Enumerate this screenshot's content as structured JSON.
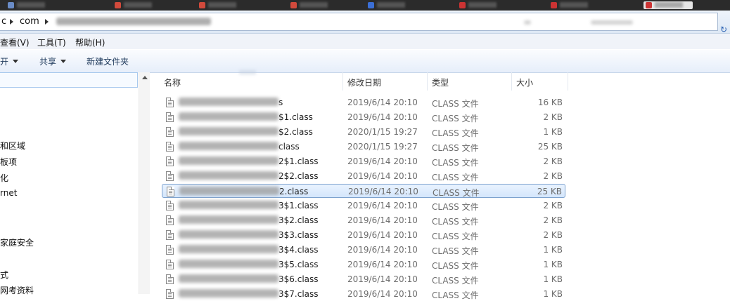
{
  "address": {
    "crumbs": [
      "c",
      "com"
    ],
    "blurred_path": "(blurred)"
  },
  "menus": [
    "查看(V)",
    "工具(T)",
    "帮助(H)"
  ],
  "toolbar": {
    "open_label": "开",
    "share_label": "共享",
    "new_folder_label": "新建文件夹"
  },
  "nav": {
    "items": [
      "和区域",
      "板项",
      "化",
      "rnet",
      "家庭安全",
      "式",
      "网考资料"
    ]
  },
  "columns": {
    "name": "名称",
    "date": "修改日期",
    "type": "类型",
    "size": "大小"
  },
  "files": [
    {
      "suffix": "s",
      "date": "2019/6/14 20:10",
      "type": "CLASS 文件",
      "size": "16 KB",
      "selected": false
    },
    {
      "suffix": "$1.class",
      "date": "2019/6/14 20:10",
      "type": "CLASS 文件",
      "size": "2 KB",
      "selected": false
    },
    {
      "suffix": "$2.class",
      "date": "2020/1/15 19:27",
      "type": "CLASS 文件",
      "size": "1 KB",
      "selected": false
    },
    {
      "suffix": "class",
      "date": "2020/1/15 19:27",
      "type": "CLASS 文件",
      "size": "25 KB",
      "selected": false
    },
    {
      "suffix": "2$1.class",
      "date": "2019/6/14 20:10",
      "type": "CLASS 文件",
      "size": "2 KB",
      "selected": false
    },
    {
      "suffix": "2$2.class",
      "date": "2019/6/14 20:10",
      "type": "CLASS 文件",
      "size": "2 KB",
      "selected": false
    },
    {
      "suffix": "2.class",
      "date": "2019/6/14 20:10",
      "type": "CLASS 文件",
      "size": "25 KB",
      "selected": true
    },
    {
      "suffix": "3$1.class",
      "date": "2019/6/14 20:10",
      "type": "CLASS 文件",
      "size": "2 KB",
      "selected": false
    },
    {
      "suffix": "3$2.class",
      "date": "2019/6/14 20:10",
      "type": "CLASS 文件",
      "size": "2 KB",
      "selected": false
    },
    {
      "suffix": "3$3.class",
      "date": "2019/6/14 20:10",
      "type": "CLASS 文件",
      "size": "2 KB",
      "selected": false
    },
    {
      "suffix": "3$4.class",
      "date": "2019/6/14 20:10",
      "type": "CLASS 文件",
      "size": "1 KB",
      "selected": false
    },
    {
      "suffix": "3$5.class",
      "date": "2019/6/14 20:10",
      "type": "CLASS 文件",
      "size": "1 KB",
      "selected": false
    },
    {
      "suffix": "3$6.class",
      "date": "2019/6/14 20:10",
      "type": "CLASS 文件",
      "size": "1 KB",
      "selected": false
    },
    {
      "suffix": "3$7.class",
      "date": "2019/6/14 20:10",
      "type": "CLASS 文件",
      "size": "1 KB",
      "selected": false
    }
  ],
  "colors": {
    "selection_border": "#7da2ce",
    "selection_fill": "#d4e6fb",
    "header_text": "#333333",
    "detail_text": "#6d6d6d"
  }
}
